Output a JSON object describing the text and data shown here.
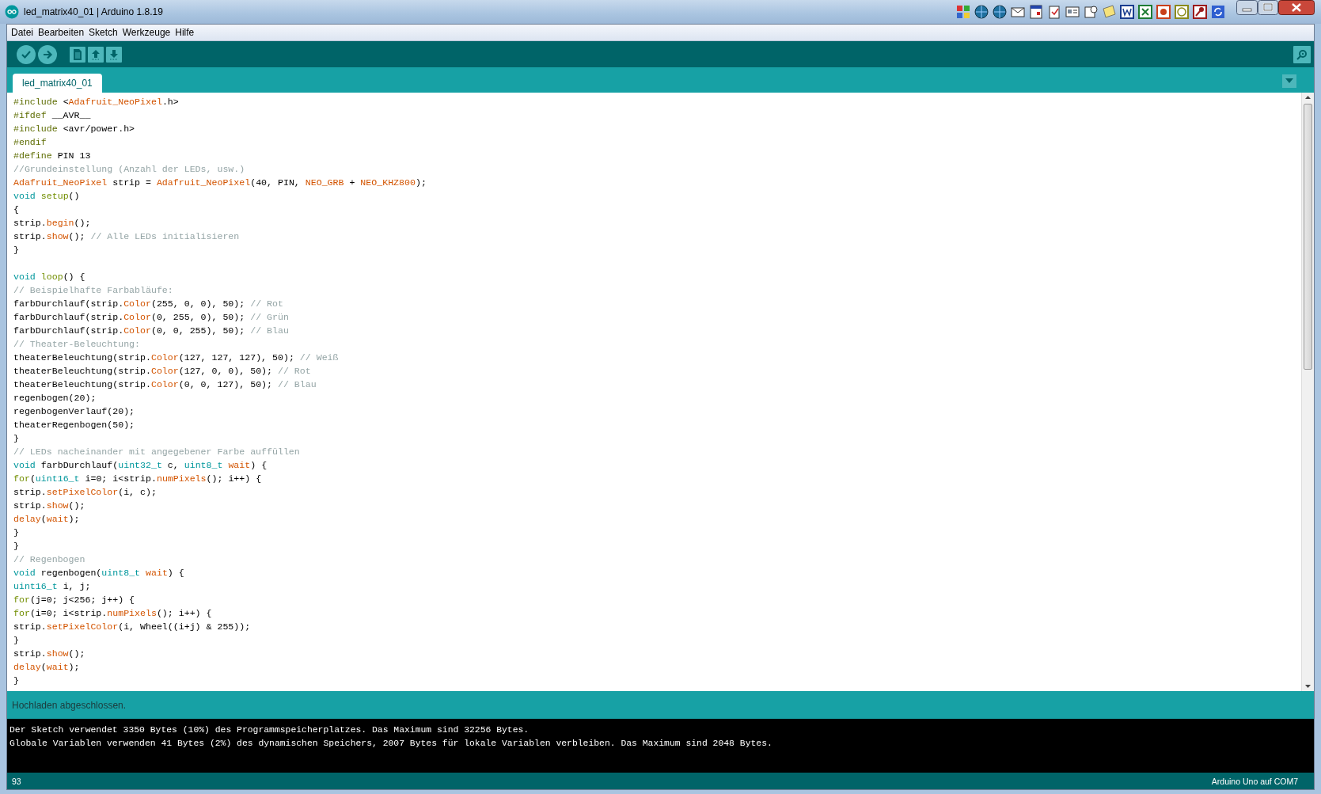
{
  "window": {
    "title": "led_matrix40_01 | Arduino 1.8.19"
  },
  "menu": [
    "Datei",
    "Bearbeiten",
    "Sketch",
    "Werkzeuge",
    "Hilfe"
  ],
  "toolbar": [
    {
      "kind": "verify"
    },
    {
      "kind": "upload"
    },
    {
      "kind": "new"
    },
    {
      "kind": "open"
    },
    {
      "kind": "save"
    }
  ],
  "tabs": [
    {
      "label": "led_matrix40_01",
      "selected": true
    }
  ],
  "editor": {
    "lines": [
      [
        {
          "text": "#include",
          "kind": "directive"
        },
        {
          "text": " <",
          "kind": "plain"
        },
        {
          "text": "Adafruit_NeoPixel",
          "kind": "func"
        },
        {
          "text": ".h>",
          "kind": "plain"
        }
      ],
      [
        {
          "text": "#ifdef",
          "kind": "directive"
        },
        {
          "text": " __AVR__",
          "kind": "plain"
        }
      ],
      [
        {
          "text": "#include",
          "kind": "directive"
        },
        {
          "text": " <avr/power.h>",
          "kind": "plain"
        }
      ],
      [
        {
          "text": "#endif",
          "kind": "directive"
        }
      ],
      [
        {
          "text": "#define",
          "kind": "directive"
        },
        {
          "text": " PIN 13",
          "kind": "plain"
        }
      ],
      [
        {
          "text": "//Grundeinstellung (Anzahl der LEDs, usw.)",
          "kind": "comment"
        }
      ],
      [
        {
          "text": "Adafruit_NeoPixel",
          "kind": "func"
        },
        {
          "text": " strip = ",
          "kind": "plain"
        },
        {
          "text": "Adafruit_NeoPixel",
          "kind": "func"
        },
        {
          "text": "(40, PIN, ",
          "kind": "plain"
        },
        {
          "text": "NEO_GRB",
          "kind": "func"
        },
        {
          "text": " + ",
          "kind": "plain"
        },
        {
          "text": "NEO_KHZ800",
          "kind": "func"
        },
        {
          "text": ");",
          "kind": "plain"
        }
      ],
      [
        {
          "text": "void ",
          "kind": "type"
        },
        {
          "text": "setup",
          "kind": "control"
        },
        {
          "text": "()",
          "kind": "plain"
        }
      ],
      [
        {
          "text": "{",
          "kind": "plain"
        }
      ],
      [
        {
          "text": "strip.",
          "kind": "plain"
        },
        {
          "text": "begin",
          "kind": "func"
        },
        {
          "text": "();",
          "kind": "plain"
        }
      ],
      [
        {
          "text": "strip.",
          "kind": "plain"
        },
        {
          "text": "show",
          "kind": "func"
        },
        {
          "text": "(); ",
          "kind": "plain"
        },
        {
          "text": "// Alle LEDs initialisieren",
          "kind": "comment"
        }
      ],
      [
        {
          "text": "}",
          "kind": "plain"
        }
      ],
      [
        {
          "kind": "blank"
        }
      ],
      [
        {
          "text": "void ",
          "kind": "type"
        },
        {
          "text": "loop",
          "kind": "control"
        },
        {
          "text": "() {",
          "kind": "plain"
        }
      ],
      [
        {
          "text": "// Beispielhafte Farbabläufe:",
          "kind": "comment"
        }
      ],
      [
        {
          "text": "farbDurchlauf(strip.",
          "kind": "plain"
        },
        {
          "text": "Color",
          "kind": "func"
        },
        {
          "text": "(255, 0, 0), 50); ",
          "kind": "plain"
        },
        {
          "text": "// Rot",
          "kind": "comment"
        }
      ],
      [
        {
          "text": "farbDurchlauf(strip.",
          "kind": "plain"
        },
        {
          "text": "Color",
          "kind": "func"
        },
        {
          "text": "(0, 255, 0), 50); ",
          "kind": "plain"
        },
        {
          "text": "// Grün",
          "kind": "comment"
        }
      ],
      [
        {
          "text": "farbDurchlauf(strip.",
          "kind": "plain"
        },
        {
          "text": "Color",
          "kind": "func"
        },
        {
          "text": "(0, 0, 255), 50); ",
          "kind": "plain"
        },
        {
          "text": "// Blau",
          "kind": "comment"
        }
      ],
      [
        {
          "text": "// Theater-Beleuchtung:",
          "kind": "comment"
        }
      ],
      [
        {
          "text": "theaterBeleuchtung(strip.",
          "kind": "plain"
        },
        {
          "text": "Color",
          "kind": "func"
        },
        {
          "text": "(127, 127, 127), 50); ",
          "kind": "plain"
        },
        {
          "text": "// Weiß",
          "kind": "comment"
        }
      ],
      [
        {
          "text": "theaterBeleuchtung(strip.",
          "kind": "plain"
        },
        {
          "text": "Color",
          "kind": "func"
        },
        {
          "text": "(127, 0, 0), 50); ",
          "kind": "plain"
        },
        {
          "text": "// Rot",
          "kind": "comment"
        }
      ],
      [
        {
          "text": "theaterBeleuchtung(strip.",
          "kind": "plain"
        },
        {
          "text": "Color",
          "kind": "func"
        },
        {
          "text": "(0, 0, 127), 50); ",
          "kind": "plain"
        },
        {
          "text": "// Blau",
          "kind": "comment"
        }
      ],
      [
        {
          "text": "regenbogen(20);",
          "kind": "plain"
        }
      ],
      [
        {
          "text": "regenbogenVerlauf(20);",
          "kind": "plain"
        }
      ],
      [
        {
          "text": "theaterRegenbogen(50);",
          "kind": "plain"
        }
      ],
      [
        {
          "text": "}",
          "kind": "plain"
        }
      ],
      [
        {
          "text": "// LEDs nacheinander mit angegebener Farbe auffüllen",
          "kind": "comment"
        }
      ],
      [
        {
          "text": "void",
          "kind": "type"
        },
        {
          "text": " farbDurchlauf(",
          "kind": "plain"
        },
        {
          "text": "uint32_t",
          "kind": "type"
        },
        {
          "text": " c, ",
          "kind": "plain"
        },
        {
          "text": "uint8_t ",
          "kind": "type"
        },
        {
          "text": "wait",
          "kind": "func"
        },
        {
          "text": ") {",
          "kind": "plain"
        }
      ],
      [
        {
          "text": "for",
          "kind": "control"
        },
        {
          "text": "(",
          "kind": "plain"
        },
        {
          "text": "uint16_t",
          "kind": "type"
        },
        {
          "text": " i=0; i<strip.",
          "kind": "plain"
        },
        {
          "text": "numPixels",
          "kind": "func"
        },
        {
          "text": "(); i++) {",
          "kind": "plain"
        }
      ],
      [
        {
          "text": "strip.",
          "kind": "plain"
        },
        {
          "text": "setPixelColor",
          "kind": "func"
        },
        {
          "text": "(i, c);",
          "kind": "plain"
        }
      ],
      [
        {
          "text": "strip.",
          "kind": "plain"
        },
        {
          "text": "show",
          "kind": "func"
        },
        {
          "text": "();",
          "kind": "plain"
        }
      ],
      [
        {
          "text": "delay",
          "kind": "func"
        },
        {
          "text": "(",
          "kind": "plain"
        },
        {
          "text": "wait",
          "kind": "func"
        },
        {
          "text": ");",
          "kind": "plain"
        }
      ],
      [
        {
          "text": "}",
          "kind": "plain"
        }
      ],
      [
        {
          "text": "}",
          "kind": "plain"
        }
      ],
      [
        {
          "text": "// Regenbogen",
          "kind": "comment"
        }
      ],
      [
        {
          "text": "void",
          "kind": "type"
        },
        {
          "text": " regenbogen(",
          "kind": "plain"
        },
        {
          "text": "uint8_t ",
          "kind": "type"
        },
        {
          "text": "wait",
          "kind": "func"
        },
        {
          "text": ") {",
          "kind": "plain"
        }
      ],
      [
        {
          "text": "uint16_t",
          "kind": "type"
        },
        {
          "text": " i, j;",
          "kind": "plain"
        }
      ],
      [
        {
          "text": "for",
          "kind": "control"
        },
        {
          "text": "(j=0; j<256; j++) {",
          "kind": "plain"
        }
      ],
      [
        {
          "text": "for",
          "kind": "control"
        },
        {
          "text": "(i=0; i<strip.",
          "kind": "plain"
        },
        {
          "text": "numPixels",
          "kind": "func"
        },
        {
          "text": "(); i++) {",
          "kind": "plain"
        }
      ],
      [
        {
          "text": "strip.",
          "kind": "plain"
        },
        {
          "text": "setPixelColor",
          "kind": "func"
        },
        {
          "text": "(i, Wheel((i+j) & 255));",
          "kind": "plain"
        }
      ],
      [
        {
          "text": "}",
          "kind": "plain"
        }
      ],
      [
        {
          "text": "strip.",
          "kind": "plain"
        },
        {
          "text": "show",
          "kind": "func"
        },
        {
          "text": "();",
          "kind": "plain"
        }
      ],
      [
        {
          "text": "delay",
          "kind": "func"
        },
        {
          "text": "(",
          "kind": "plain"
        },
        {
          "text": "wait",
          "kind": "func"
        },
        {
          "text": ");",
          "kind": "plain"
        }
      ],
      [
        {
          "text": "}",
          "kind": "plain"
        }
      ]
    ]
  },
  "message": "Hochladen abgeschlossen.",
  "console": [
    "Der Sketch verwendet 3350 Bytes (10%) des Programmspeicherplatzes. Das Maximum sind 32256 Bytes.",
    "Globale Variablen verwenden 41 Bytes (2%) des dynamischen Speichers, 2007 Bytes für lokale Variablen verbleiben. Das Maximum sind 2048 Bytes."
  ],
  "status_bar": {
    "line": "93",
    "board": "Arduino Uno auf COM7"
  }
}
